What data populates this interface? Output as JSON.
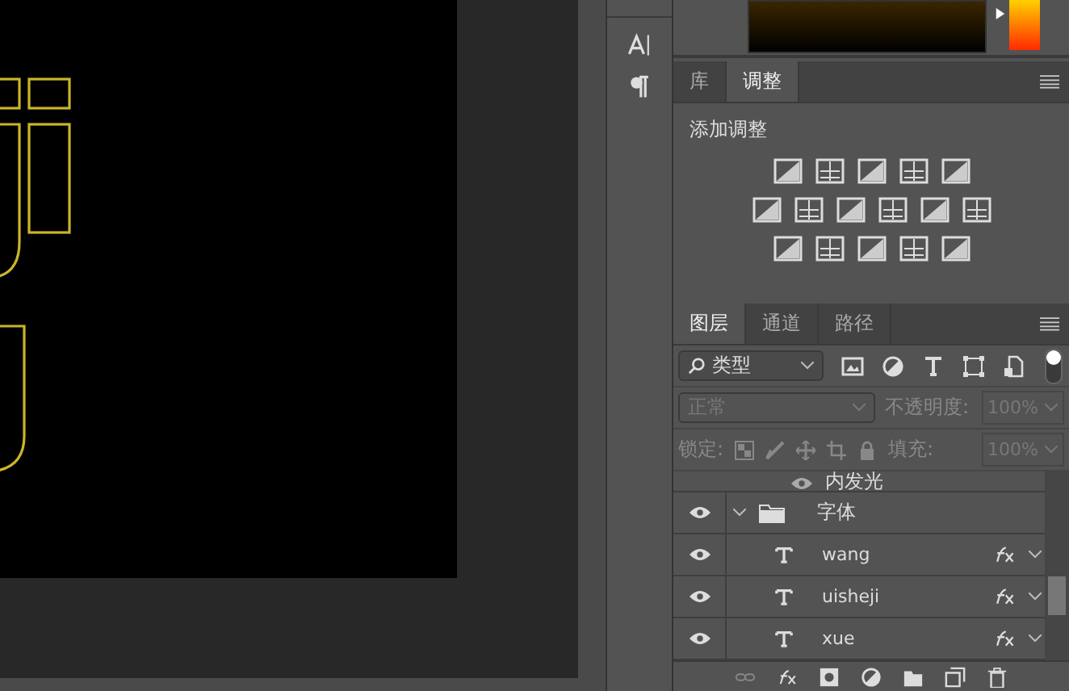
{
  "adjust_tabs": [
    {
      "label": "库",
      "selected": false
    },
    {
      "label": "调整",
      "selected": true
    }
  ],
  "adjustments": {
    "title": "添加调整"
  },
  "layer_tabs": [
    {
      "label": "图层",
      "selected": true
    },
    {
      "label": "通道",
      "selected": false
    },
    {
      "label": "路径",
      "selected": false
    }
  ],
  "filter": {
    "value": "类型",
    "on": true
  },
  "blend": {
    "value": "正常",
    "disabled": true
  },
  "color_picker": {
    "level": 0.85
  },
  "opacity": {
    "label": "不透明度:",
    "value": "100%",
    "disabled": true
  },
  "lock": {
    "label": "锁定:"
  },
  "fill": {
    "label": "填充:",
    "value": "100%",
    "disabled": true
  },
  "layers": [
    {
      "name": "内发光",
      "kind": "effect",
      "visible": true
    },
    {
      "name": "字体",
      "kind": "group",
      "visible": true,
      "expanded": true,
      "children": [
        {
          "name": "wang",
          "kind": "text",
          "visible": true,
          "fx": true
        },
        {
          "name": "uisheji",
          "kind": "text",
          "visible": true,
          "fx": true
        },
        {
          "name": "xue",
          "kind": "text",
          "visible": true,
          "fx": true
        }
      ]
    }
  ]
}
